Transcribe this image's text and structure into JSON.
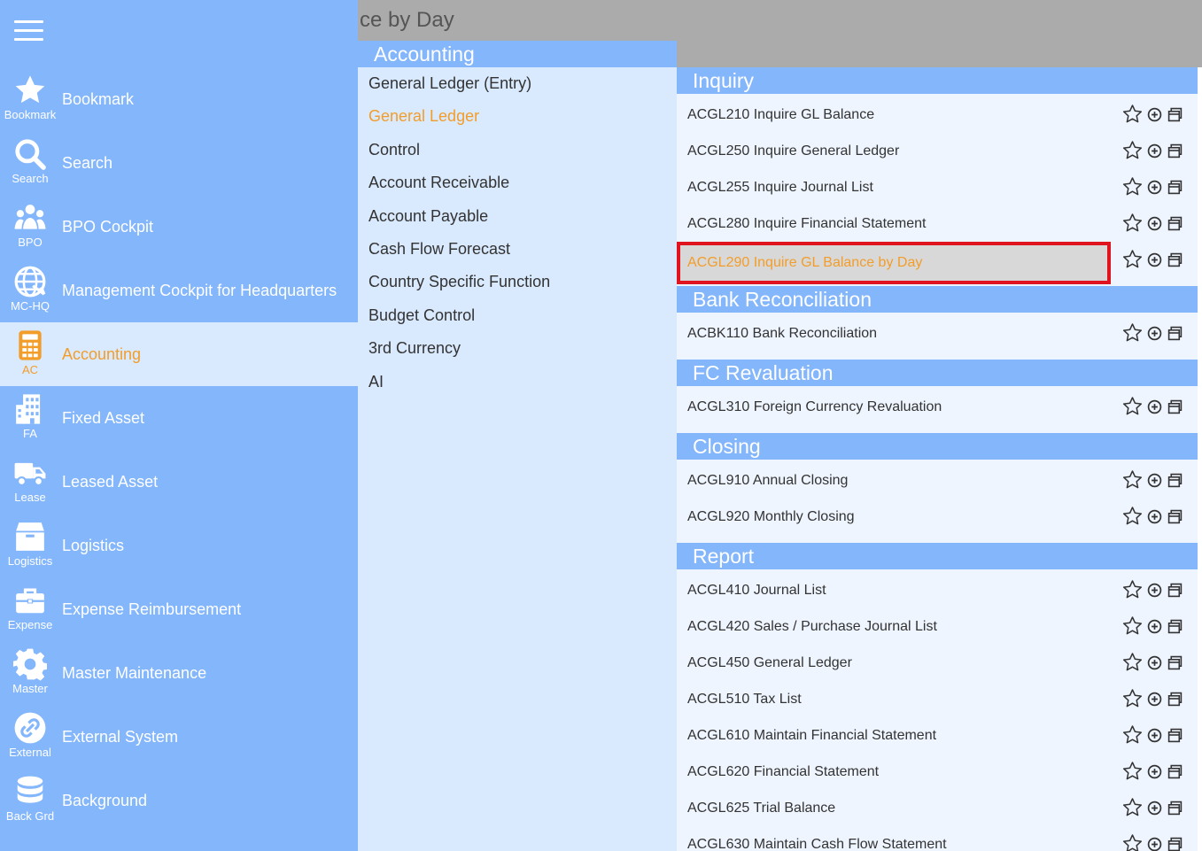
{
  "header": {
    "title": "ce by Day"
  },
  "sidebar": {
    "items": [
      {
        "label": "Bookmark",
        "short": "Bookmark",
        "icon": "star-icon"
      },
      {
        "label": "Search",
        "short": "Search",
        "icon": "search-icon"
      },
      {
        "label": "BPO Cockpit",
        "short": "BPO",
        "icon": "people-icon"
      },
      {
        "label": "Management Cockpit for Headquarters",
        "short": "MC-HQ",
        "icon": "globe-icon"
      },
      {
        "label": "Accounting",
        "short": "AC",
        "icon": "calculator-icon",
        "active": true
      },
      {
        "label": "Fixed Asset",
        "short": "FA",
        "icon": "building-icon"
      },
      {
        "label": "Leased Asset",
        "short": "Lease",
        "icon": "truck-icon"
      },
      {
        "label": "Logistics",
        "short": "Logistics",
        "icon": "box-icon"
      },
      {
        "label": "Expense Reimbursement",
        "short": "Expense",
        "icon": "briefcase-icon"
      },
      {
        "label": "Master Maintenance",
        "short": "Master",
        "icon": "gear-icon"
      },
      {
        "label": "External System",
        "short": "External",
        "icon": "link-icon"
      },
      {
        "label": "Background",
        "short": "Back Grd",
        "icon": "database-icon"
      }
    ]
  },
  "category": {
    "title": "Accounting",
    "items": [
      "General Ledger (Entry)",
      "General Ledger",
      "Control",
      "Account Receivable",
      "Account Payable",
      "Cash Flow Forecast",
      "Country Specific Function",
      "Budget Control",
      "3rd Currency",
      "AI"
    ],
    "active_index": 1
  },
  "sections": [
    {
      "title": "Inquiry",
      "items": [
        "ACGL210 Inquire GL Balance",
        "ACGL250 Inquire General Ledger",
        "ACGL255 Inquire Journal List",
        "ACGL280 Inquire Financial Statement",
        "ACGL290 Inquire GL Balance by Day"
      ]
    },
    {
      "title": "Bank Reconciliation",
      "items": [
        "ACBK110 Bank Reconciliation"
      ]
    },
    {
      "title": "FC Revaluation",
      "items": [
        "ACGL310 Foreign Currency Revaluation"
      ]
    },
    {
      "title": "Closing",
      "items": [
        "ACGL910 Annual Closing",
        "ACGL920 Monthly Closing"
      ]
    },
    {
      "title": "Report",
      "items": [
        "ACGL410 Journal List",
        "ACGL420 Sales / Purchase Journal List",
        "ACGL450 General Ledger",
        "ACGL510 Tax List",
        "ACGL610 Maintain Financial Statement",
        "ACGL620 Financial Statement",
        "ACGL625 Trial Balance",
        "ACGL630 Maintain Cash Flow Statement"
      ]
    }
  ],
  "selected_function": "ACGL290 Inquire GL Balance by Day",
  "colors": {
    "sidebar": "#84b6fc",
    "active_bg": "#d9e9fe",
    "accent": "#f29d2a",
    "highlight_border": "#e0141e"
  }
}
